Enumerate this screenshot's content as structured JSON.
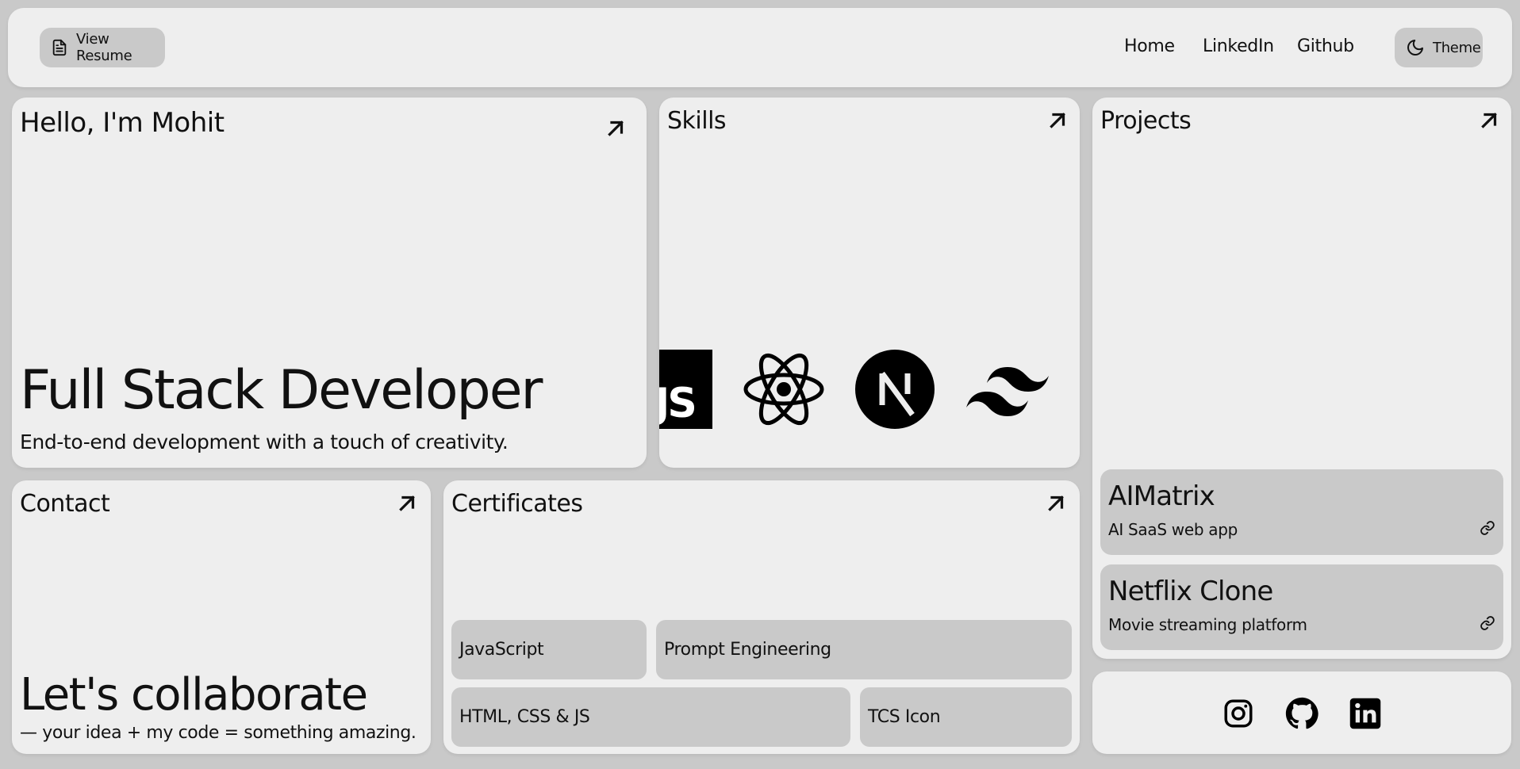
{
  "header": {
    "resume_label": "View Resume",
    "nav": [
      "Home",
      "LinkedIn",
      "Github"
    ],
    "theme_label": "Theme"
  },
  "hero": {
    "greeting": "Hello, I'm Mohit",
    "headline": "Full Stack Developer",
    "tagline": "End-to-end development with a touch of creativity."
  },
  "skills": {
    "title": "Skills",
    "icons": [
      "javascript-icon",
      "react-icon",
      "nextjs-icon",
      "tailwind-icon"
    ],
    "js_text": "JS"
  },
  "projects": {
    "title": "Projects",
    "items": [
      {
        "name": "AIMatrix",
        "desc": "AI SaaS web app"
      },
      {
        "name": "Netflix Clone",
        "desc": "Movie streaming platform"
      }
    ]
  },
  "contact": {
    "title": "Contact",
    "headline": "Let's collaborate",
    "tagline": "— your idea + my code = something amazing."
  },
  "certificates": {
    "title": "Certificates",
    "items": [
      "JavaScript",
      "Prompt Engineering",
      "HTML, CSS & JS",
      "TCS Icon"
    ]
  },
  "social": {
    "icons": [
      "instagram-icon",
      "github-icon",
      "linkedin-icon"
    ]
  },
  "colors": {
    "background": "#c9c9c9",
    "card": "#eeeeee",
    "chip": "#c9c9c9",
    "text": "#111111"
  }
}
